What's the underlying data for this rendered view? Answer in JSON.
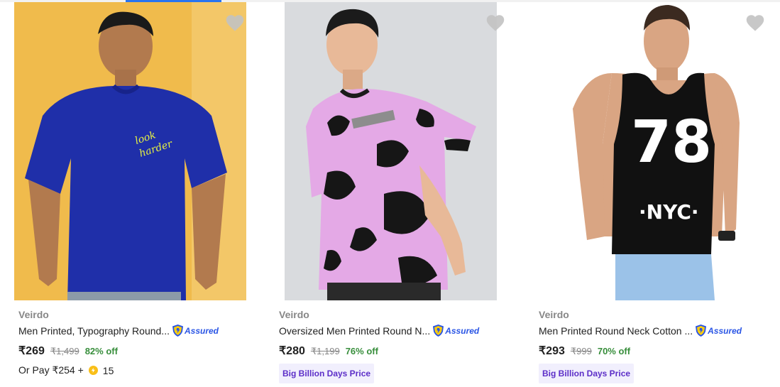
{
  "colors": {
    "accent": "#2874f0",
    "discount": "#388e3c",
    "muted": "#878787",
    "assured": "#2a55e5",
    "deal_bg": "#f1effd",
    "deal_text": "#5c2ec8",
    "wishlist_icon": "#c2c2c2"
  },
  "products": [
    {
      "image_icon": "product-photo-blue-tshirt",
      "brand": "Veirdo",
      "title": "Men Printed, Typography Round...",
      "assured_label": "Assured",
      "price": "₹269",
      "mrp": "₹1,499",
      "discount": "82% off",
      "pay_later_text": "Or Pay ₹254 +",
      "coins": "15"
    },
    {
      "image_icon": "product-photo-pink-cow-print-tshirt",
      "brand": "Veirdo",
      "title": "Oversized Men Printed Round N...",
      "assured_label": "Assured",
      "price": "₹280",
      "mrp": "₹1,199",
      "discount": "76% off",
      "deal_label": "Big Billion Days Price"
    },
    {
      "image_icon": "product-photo-black-nyc-vest",
      "brand": "Veirdo",
      "title": "Men Printed Round Neck Cotton ...",
      "assured_label": "Assured",
      "price": "₹293",
      "mrp": "₹999",
      "discount": "70% off",
      "deal_label": "Big Billion Days Price"
    }
  ]
}
